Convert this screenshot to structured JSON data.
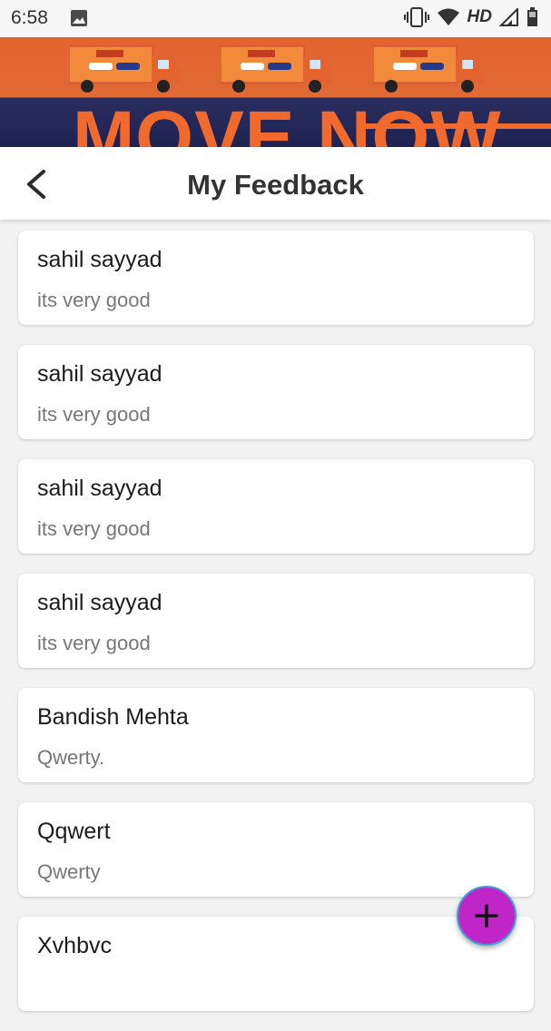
{
  "status_bar": {
    "time": "6:58",
    "network_label": "HD"
  },
  "banner": {
    "headline": "MOVE NOW",
    "colors": {
      "orange": "#e4622e",
      "navy": "#1f2352"
    }
  },
  "header": {
    "title": "My Feedback"
  },
  "feedback_items": [
    {
      "name": "sahil sayyad",
      "message": "its very good"
    },
    {
      "name": "sahil sayyad",
      "message": "its very good"
    },
    {
      "name": "sahil sayyad",
      "message": "its very good"
    },
    {
      "name": "sahil sayyad",
      "message": "its very good"
    },
    {
      "name": "Bandish Mehta",
      "message": "Qwerty."
    },
    {
      "name": "Qqwert",
      "message": "Qwerty"
    },
    {
      "name": "Xvhbvc",
      "message": ""
    }
  ],
  "fab": {
    "icon": "plus-icon",
    "color": "#c026c7"
  }
}
